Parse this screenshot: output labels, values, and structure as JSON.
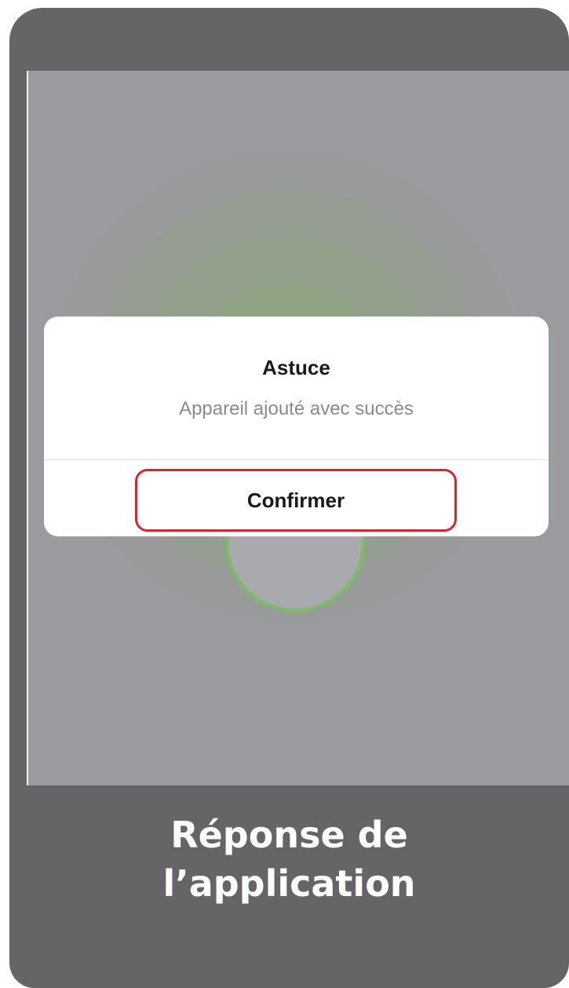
{
  "dialog": {
    "title": "Astuce",
    "message": "Appareil ajouté avec succès",
    "confirm_label": "Confirmer",
    "confirm_highlight_color": "#d9262e"
  },
  "caption": {
    "line1": "Réponse de",
    "line2": "l’application"
  },
  "colors": {
    "frame": "#666466",
    "screen_overlay": "#9a9b9f",
    "pairing_ring": "#7fb86c"
  }
}
